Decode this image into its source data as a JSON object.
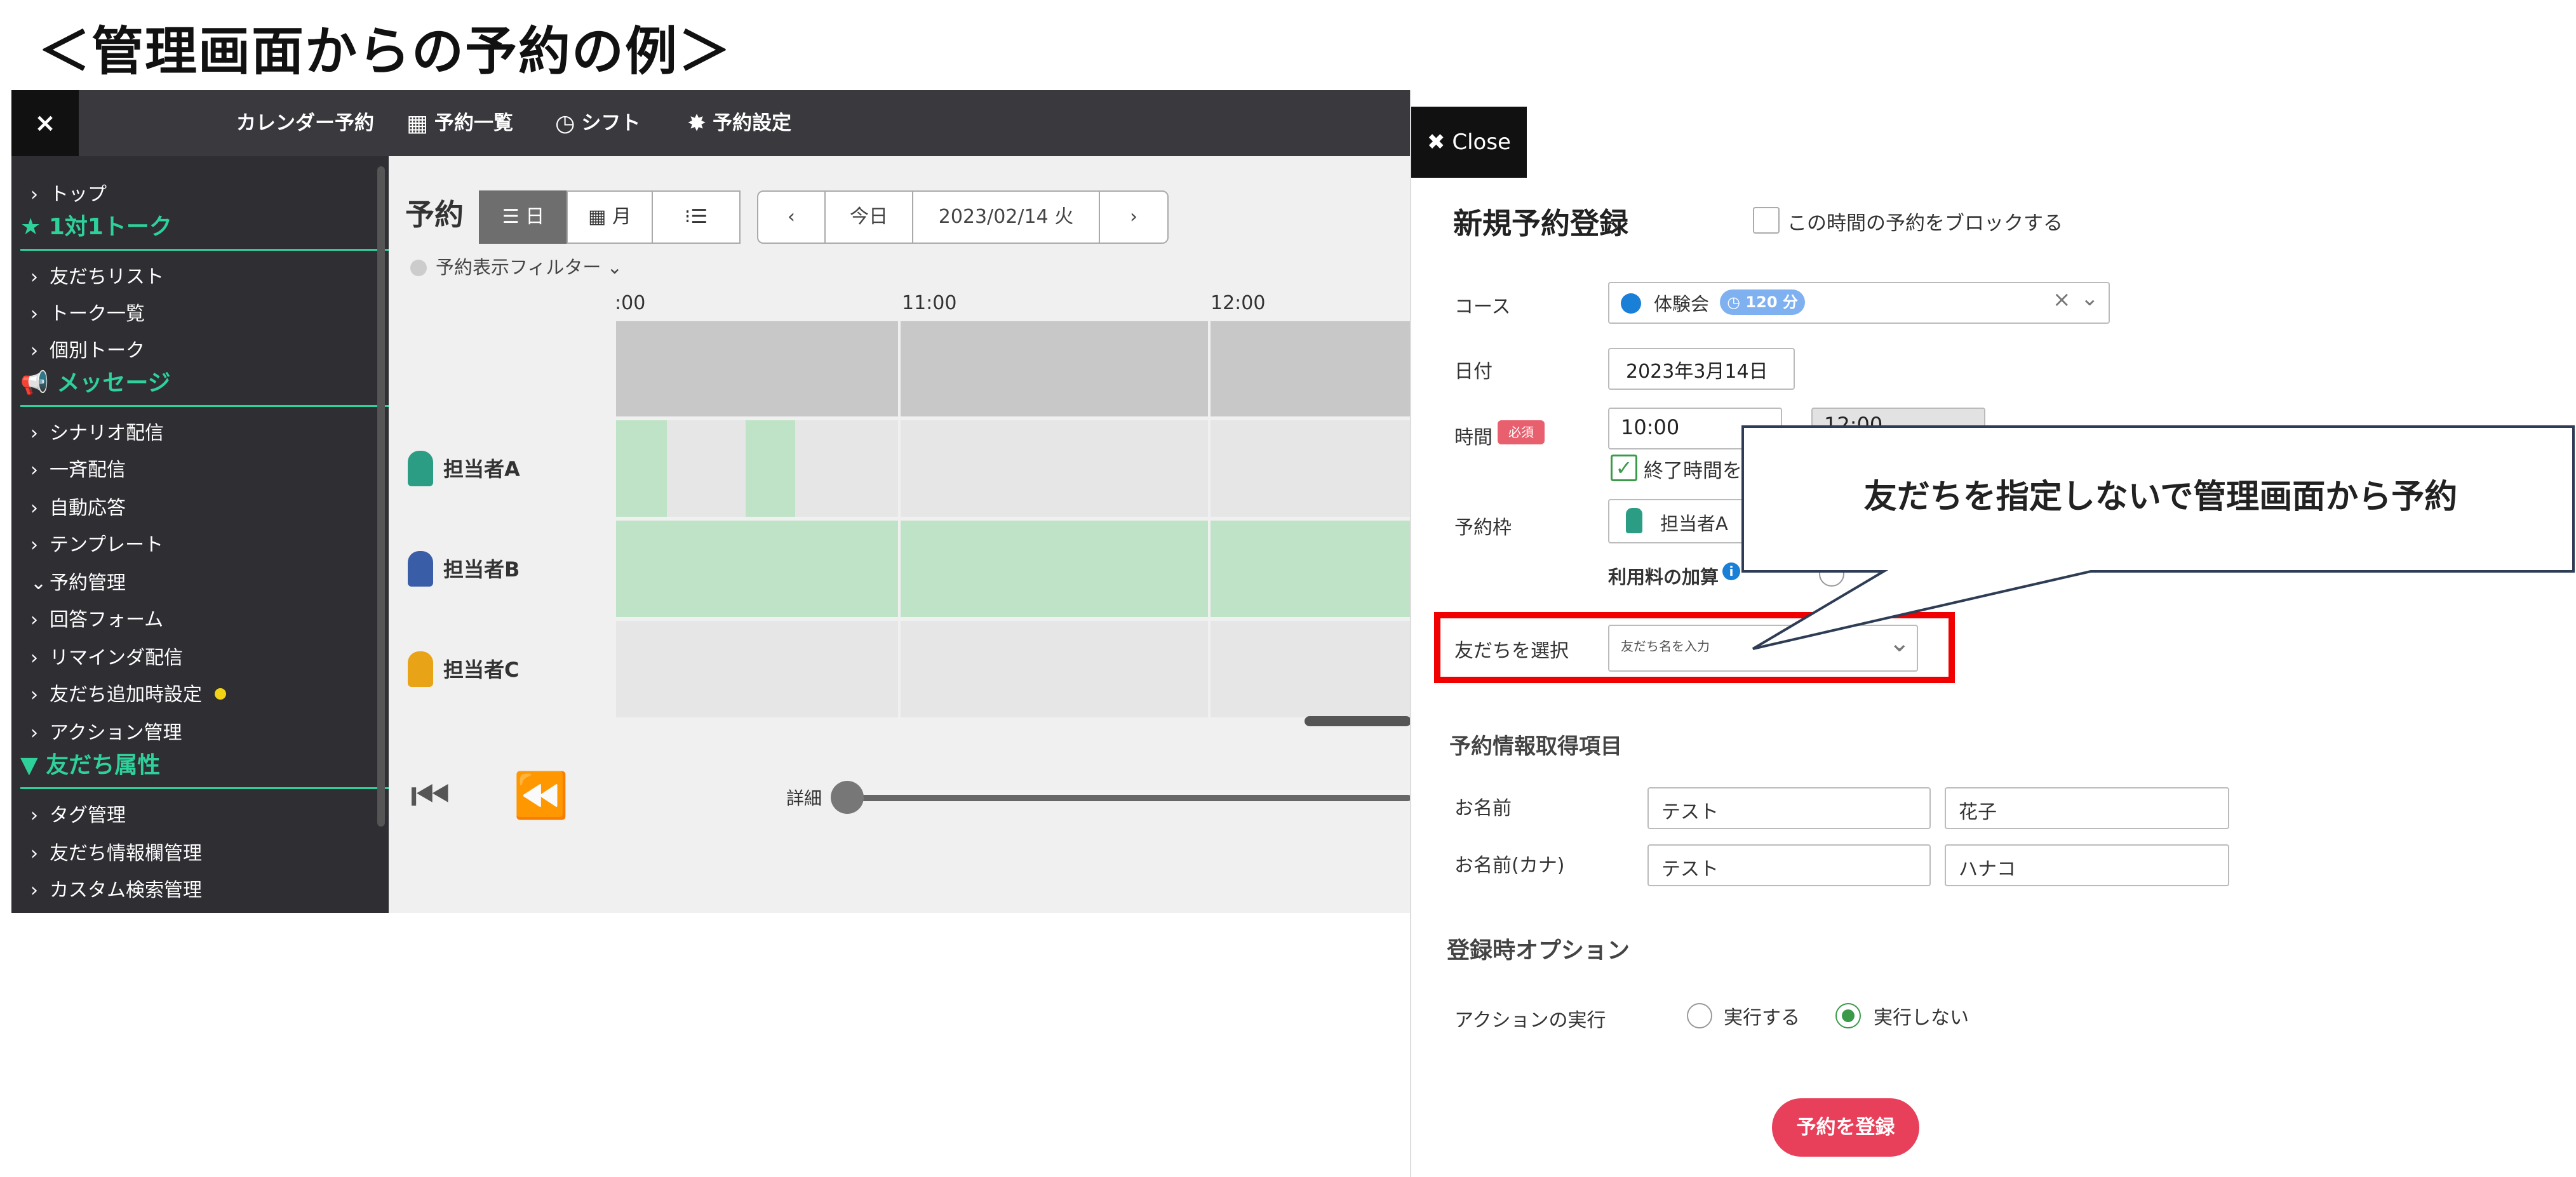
{
  "page_heading": "＜管理画面からの予約の例＞",
  "topbar": {
    "close_icon": "×",
    "calendar_booking": "カレンダー予約",
    "booking_list": "予約一覧",
    "shift": "シフト",
    "booking_settings": "予約設定"
  },
  "sidebar": {
    "top": "トップ",
    "section_1on1": "1対1トーク",
    "friend_list": "友だちリスト",
    "talk_list": "トーク一覧",
    "individual_talk": "個別トーク",
    "section_message": "メッセージ",
    "scenario": "シナリオ配信",
    "broadcast": "一斉配信",
    "auto_reply": "自動応答",
    "template": "テンプレート",
    "booking_mgmt": "予約管理",
    "answer_form": "回答フォーム",
    "reminder": "リマインダ配信",
    "friend_add_settings": "友だち追加時設定",
    "action_mgmt": "アクション管理",
    "section_friend_attr": "友だち属性",
    "tag_mgmt": "タグ管理",
    "friend_info_mgmt": "友だち情報欄管理",
    "custom_search": "カスタム検索管理"
  },
  "calendar": {
    "title": "予約",
    "view_day": "日",
    "view_month": "月",
    "today": "今日",
    "date": "2023/02/14 火",
    "filter": "予約表示フィルター",
    "times": [
      ":00",
      "11:00",
      "12:00"
    ],
    "staff": [
      "担当者A",
      "担当者B",
      "担当者C"
    ],
    "detail_label": "詳細"
  },
  "modal": {
    "close": "Close",
    "title": "新規予約登録",
    "block_label": "この時間の予約をブロックする",
    "course_label": "コース",
    "course_name": "体験会",
    "course_duration": "120 分",
    "date_label": "日付",
    "date_value": "2023年3月14日",
    "time_label": "時間",
    "required": "必須",
    "time_start": "10:00",
    "time_end": "12:00",
    "end_time_checkbox": "終了時間を",
    "slot_label": "予約枠",
    "slot_staff": "担当者A",
    "fee_label": "利用料の加算",
    "friend_label": "友だちを選択",
    "friend_placeholder": "友だち名を入力",
    "info_heading": "予約情報取得項目",
    "name_label": "お名前",
    "name_last": "テスト",
    "name_first": "花子",
    "kana_label": "お名前(カナ)",
    "kana_last": "テスト",
    "kana_first": "ハナコ",
    "options_heading": "登録時オプション",
    "action_label": "アクションの実行",
    "run": "実行する",
    "no_run": "実行しない",
    "submit": "予約を登録"
  },
  "callout": {
    "text": "友だちを指定しないで管理画面から予約"
  },
  "colors": {
    "accent_green": "#2fd19b",
    "highlight_red": "#f00000",
    "submit_pink": "#e8405a",
    "booked_green": "#bfe3c7"
  }
}
